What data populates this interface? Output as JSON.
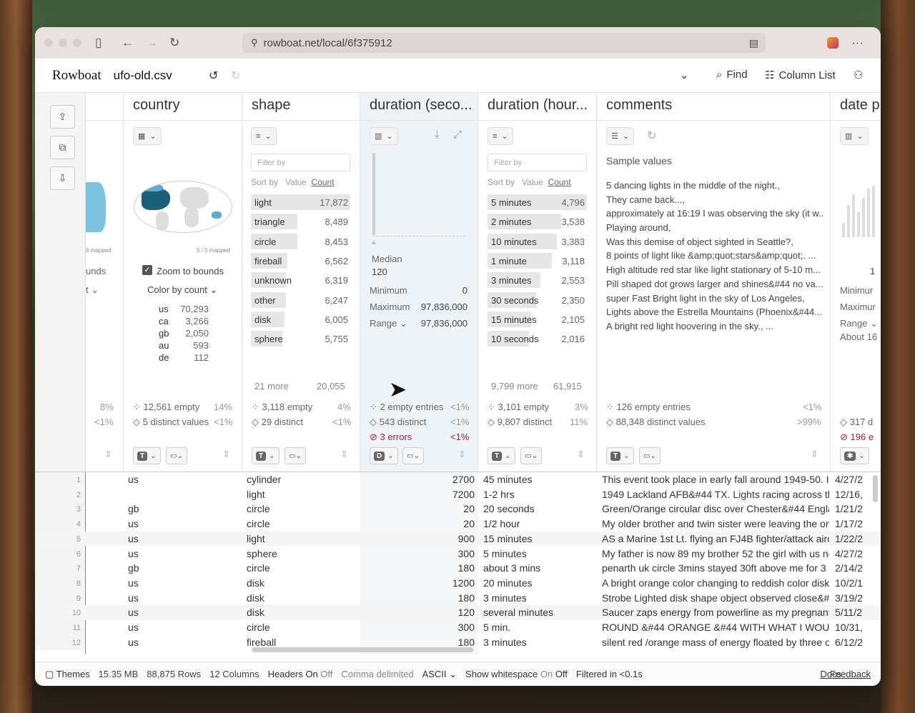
{
  "browser": {
    "url": "rowboat.net/local/6f375912"
  },
  "app": {
    "logo": "Rowboat",
    "filename": "ufo-old.csv",
    "find": "Find",
    "column_list": "Column List"
  },
  "country": {
    "header": "country",
    "map_left_caption": "8 mapped",
    "map_caption": "5 / 5 mapped",
    "left_bounds": "unds",
    "left_t": "t",
    "zoom": "Zoom to bounds",
    "color_by": "Color by count",
    "legend": [
      {
        "k": "us",
        "v": "70,293"
      },
      {
        "k": "ca",
        "v": "3,266"
      },
      {
        "k": "gb",
        "v": "2,050"
      },
      {
        "k": "au",
        "v": "593"
      },
      {
        "k": "de",
        "v": "112"
      }
    ],
    "empty": "12,561 empty",
    "empty_pct": "14%",
    "distinct": "5 distinct values",
    "distinct_pct": "<1%",
    "left_pct1": "8%",
    "left_pct2": "<1%"
  },
  "shape": {
    "header": "shape",
    "filter": "Filter by",
    "sort_by": "Sort by",
    "value": "Value",
    "count": "Count",
    "values": [
      {
        "l": "light",
        "c": "17,872",
        "f": 1
      },
      {
        "l": "triangle",
        "c": "8,489",
        "f": 0.47
      },
      {
        "l": "circle",
        "c": "8,453",
        "f": 0.47
      },
      {
        "l": "fireball",
        "c": "6,562",
        "f": 0.37
      },
      {
        "l": "unknown",
        "c": "6,319",
        "f": 0.35
      },
      {
        "l": "other",
        "c": "6,247",
        "f": 0.35
      },
      {
        "l": "disk",
        "c": "6,005",
        "f": 0.34
      },
      {
        "l": "sphere",
        "c": "5,755",
        "f": 0.32
      }
    ],
    "more": "21 more",
    "more_count": "20,055",
    "empty": "3,118 empty",
    "empty_pct": "4%",
    "distinct": "29 distinct",
    "distinct_pct": "<1%"
  },
  "dsec": {
    "header": "duration (seco...",
    "median_label": "Median",
    "median": "120",
    "min_label": "Minimum",
    "min": "0",
    "max_label": "Maximum",
    "max": "97,836,000",
    "range_label": "Range",
    "range": "97,836,000",
    "empty": "2 empty entries",
    "empty_pct": "<1%",
    "distinct": "543 distinct",
    "distinct_pct": "<1%",
    "errors": "3 errors",
    "errors_pct": "<1%"
  },
  "dhour": {
    "header": "duration (hour...",
    "filter": "Filter by",
    "sort_by": "Sort by",
    "value": "Value",
    "count": "Count",
    "values": [
      {
        "l": "5 minutes",
        "c": "4,796",
        "f": 1
      },
      {
        "l": "2 minutes",
        "c": "3,538",
        "f": 0.74
      },
      {
        "l": "10 minutes",
        "c": "3,383",
        "f": 0.7
      },
      {
        "l": "1 minute",
        "c": "3,118",
        "f": 0.65
      },
      {
        "l": "3 minutes",
        "c": "2,553",
        "f": 0.53
      },
      {
        "l": "30 seconds",
        "c": "2,350",
        "f": 0.49
      },
      {
        "l": "15 minutes",
        "c": "2,105",
        "f": 0.44
      },
      {
        "l": "10 seconds",
        "c": "2,016",
        "f": 0.42
      }
    ],
    "more": "9,799 more",
    "more_count": "61,915",
    "empty": "3,101 empty",
    "empty_pct": "3%",
    "distinct": "9,807 distinct",
    "distinct_pct": "11%"
  },
  "comments": {
    "header": "comments",
    "sample": "Sample values",
    "samples": [
      "5 dancing lights in the middle of the night.,",
      "They came back...,",
      "approximately at 16:19 I was observing the sky (it w...",
      "Playing around,",
      "Was this demise of object sighted in Seattle?,",
      "8 points of light like &amp;quot;stars&amp;quot;. ...",
      "High altitude red star like light stationary of 5-10 m...",
      "Pill shaped dot grows larger and shines&#44 no va...",
      "super Fast Bright light in the sky of Los Angeles,",
      "Lights above the Estrella Mountains (Phoenix&#44...",
      "A bright red light hoovering in the sky., ..."
    ],
    "empty": "126 empty entries",
    "empty_pct": "<1%",
    "distinct": "88,348 distinct values",
    "distinct_pct": ">99%"
  },
  "date": {
    "header": "date p",
    "one": "1",
    "min": "Minimur",
    "max": "Maximur",
    "range": "Range",
    "about": "About 16",
    "distinct": "317 d",
    "errors": "196 e"
  },
  "rows": [
    {
      "n": "1",
      "country": "us",
      "shape": "cylinder",
      "dsec": "2700",
      "dhour": "45 minutes",
      "comment": "This event took place in early fall around 1949-50. It",
      "date": "4/27/2"
    },
    {
      "n": "2",
      "country": "",
      "shape": "light",
      "dsec": "7200",
      "dhour": "1-2 hrs",
      "comment": "1949 Lackland AFB&#44 TX.  Lights racing across th",
      "date": "12/16,"
    },
    {
      "n": "3",
      "country": "gb",
      "shape": "circle",
      "dsec": "20",
      "dhour": "20 seconds",
      "comment": "Green/Orange circular disc over Chester&#44 Englar",
      "date": "1/21/2"
    },
    {
      "n": "4",
      "country": "us",
      "shape": "circle",
      "dsec": "20",
      "dhour": "1/2 hour",
      "comment": "My older brother and twin sister were leaving the only",
      "date": "1/17/2"
    },
    {
      "n": "5",
      "country": "us",
      "shape": "light",
      "dsec": "900",
      "dhour": "15 minutes",
      "comment": "AS a Marine 1st Lt. flying an FJ4B fighter/attack aircr",
      "date": "1/22/2"
    },
    {
      "n": "6",
      "country": "us",
      "shape": "sphere",
      "dsec": "300",
      "dhour": "5 minutes",
      "comment": "My father is now 89 my brother 52 the girl with us no",
      "date": "4/27/2"
    },
    {
      "n": "7",
      "country": "gb",
      "shape": "circle",
      "dsec": "180",
      "dhour": "about 3 mins",
      "comment": "penarth uk  circle  3mins  stayed 30ft above me for 3",
      "date": "2/14/2"
    },
    {
      "n": "8",
      "country": "us",
      "shape": "disk",
      "dsec": "1200",
      "dhour": "20 minutes",
      "comment": "A bright orange color changing to reddish color disk/s",
      "date": "10/2/1"
    },
    {
      "n": "9",
      "country": "us",
      "shape": "disk",
      "dsec": "180",
      "dhour": "3  minutes",
      "comment": "Strobe Lighted disk shape object observed close&#4",
      "date": "3/19/2"
    },
    {
      "n": "10",
      "country": "us",
      "shape": "disk",
      "dsec": "120",
      "dhour": "several minutes",
      "comment": "Saucer zaps energy from powerline as my pregnant n",
      "date": "5/11/2"
    },
    {
      "n": "11",
      "country": "us",
      "shape": "circle",
      "dsec": "300",
      "dhour": "5 min.",
      "comment": "ROUND &#44 ORANGE &#44 WITH WHAT I WOULD",
      "date": "10/31,"
    },
    {
      "n": "12",
      "country": "us",
      "shape": "fireball",
      "dsec": "180",
      "dhour": "3 minutes",
      "comment": "silent red /orange mass of energy floated by three of",
      "date": "6/12/2"
    }
  ],
  "status": {
    "themes": "Themes",
    "size": "15.35 MB",
    "rows": "88,875 Rows",
    "cols": "12 Columns",
    "headers": "Headers",
    "on": "On",
    "off": "Off",
    "delim": "Comma delimited",
    "enc": "ASCII",
    "ws": "Show whitespace",
    "filtered": "Filtered in <0.1s",
    "docs": "Docs",
    "feedback": "Feedback"
  }
}
